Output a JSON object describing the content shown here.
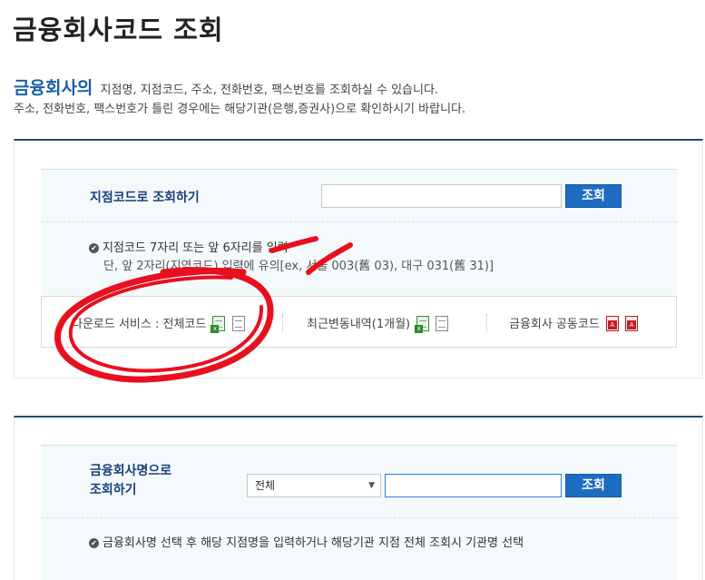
{
  "page": {
    "title": "금융회사코드 조회"
  },
  "intro": {
    "strong": "금융회사의",
    "line1_rest": "지점명, 지점코드, 주소, 전화번호, 팩스번호를 조회하실 수 있습니다.",
    "line2": "주소, 전화번호, 팩스번호가 틀린 경우에는 해당기관(은행,증권사)으로 확인하시기 바랍니다."
  },
  "branch_search": {
    "label": "지점코드로 조회하기",
    "input_value": "",
    "button_label": "조회",
    "note_line1": "지점코드 7자리 또는 앞 6자리를 입력",
    "note_line2": "단, 앞 2자리(지역코드) 입력에 유의[ex, 서울 003(舊 03), 대구 031(舊 31)]"
  },
  "downloads": {
    "item1_label": "다운로드 서비스 : 전체코드",
    "item2_label": "최근변동내역(1개월)",
    "item3_label": "금융회사 공동코드",
    "item1_icons": [
      "excel-file-icon",
      "text-file-icon"
    ],
    "item2_icons": [
      "excel-file-icon",
      "text-file-icon"
    ],
    "item3_icons": [
      "pdf-file-icon",
      "pdf-file-icon"
    ]
  },
  "name_search": {
    "label_line1": "금융회사명으로",
    "label_line2": "조회하기",
    "select_value": "전체",
    "input_value": "",
    "button_label": "조회",
    "note": "금융회사명 선택 후 해당 지점명을 입력하거나 해당기관 지점 전체 조회시 기관명 선택"
  },
  "colors": {
    "accent_blue": "#1d6cc1",
    "heading_blue": "#1b5fa8",
    "section_border": "#1d4f73",
    "annotation_red": "#e8101e"
  }
}
